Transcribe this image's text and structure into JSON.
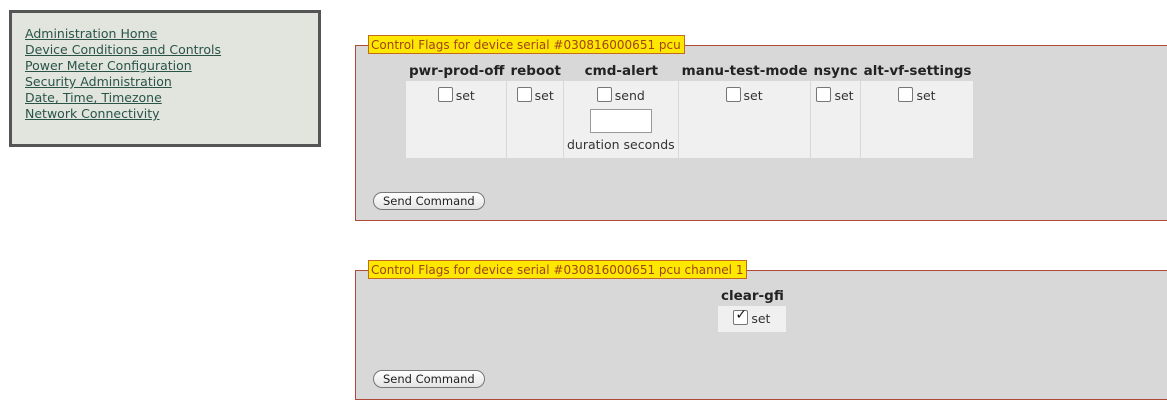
{
  "nav": {
    "links": [
      "Administration Home",
      "Device Conditions and Controls",
      "Power Meter Configuration",
      "Security Administration",
      "Date, Time, Timezone",
      "Network Connectivity"
    ]
  },
  "panel1": {
    "legend": "Control Flags for device serial #030816000651 pcu",
    "columns": [
      "pwr-prod-off",
      "reboot",
      "cmd-alert",
      "manu-test-mode",
      "nsync",
      "alt-vf-settings"
    ],
    "cells": [
      {
        "label": "set",
        "checked": false
      },
      {
        "label": "set",
        "checked": false
      },
      {
        "label": "send",
        "checked": false
      },
      {
        "label": "set",
        "checked": false
      },
      {
        "label": "set",
        "checked": false
      },
      {
        "label": "set",
        "checked": false
      }
    ],
    "duration_value": "",
    "duration_label": "duration seconds",
    "button": "Send Command"
  },
  "panel2": {
    "legend": "Control Flags for device serial #030816000651 pcu channel 1",
    "columns": [
      "clear-gfi"
    ],
    "cells": [
      {
        "label": "set",
        "checked": true
      }
    ],
    "button": "Send Command"
  },
  "colors": {
    "nav_bg": "#e1e5dd",
    "legend_bg": "#ffe800",
    "panel_border": "#b04a38",
    "panel_bg": "#d8d8d8"
  }
}
